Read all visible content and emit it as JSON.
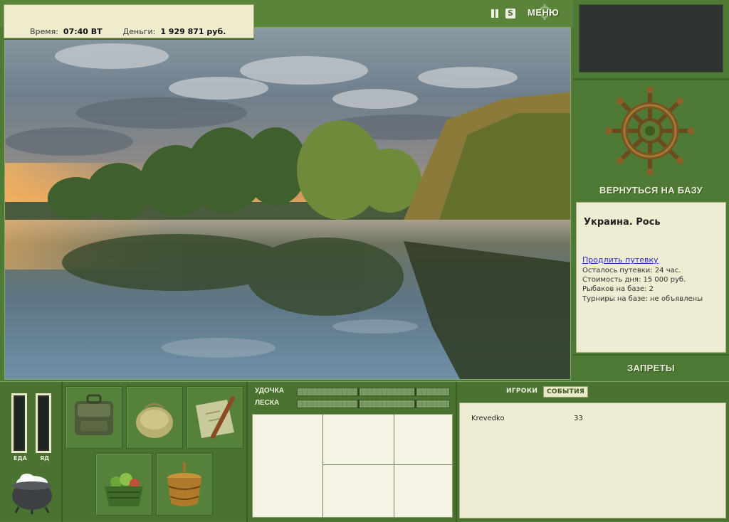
{
  "status": {
    "time_label": "Время:",
    "time_value": "07:40 ВТ",
    "money_label": "Деньги:",
    "money_value": "1 929 871 руб."
  },
  "top_menu": {
    "sound_label": "S",
    "menu_label": "МЕНЮ"
  },
  "sidebar": {
    "return_label": "ВЕРНУТЬСЯ НА БАЗУ",
    "bans_label": "ЗАПРЕТЫ"
  },
  "location": {
    "title": "Украина. Рось",
    "extend_link": "Продлить путевку",
    "permit_left": "Осталось путевки: 24 час.",
    "day_cost": "Стоимость дня: 15 000 руб.",
    "fishers": "Рыбаков на базе: 2",
    "tournaments": "Турниры на базе: не объявлены"
  },
  "meters": {
    "food_label": "ЕДА",
    "poison_label": "ЯД"
  },
  "inventory": {
    "slots": [
      "backpack",
      "sack",
      "map-with-rod",
      "vegetable-basket",
      "wooden-bucket"
    ]
  },
  "rig": {
    "rod_label": "УДОЧКА",
    "line_label": "ЛЕСКА"
  },
  "social": {
    "players_tab": "ИГРОКИ",
    "events_tab": "СОБЫТИЯ",
    "players": [
      {
        "name": "Krevedko",
        "score": "33"
      }
    ]
  },
  "colors": {
    "ui_green": "#4f7a35",
    "panel_cream": "#eeecd2"
  }
}
